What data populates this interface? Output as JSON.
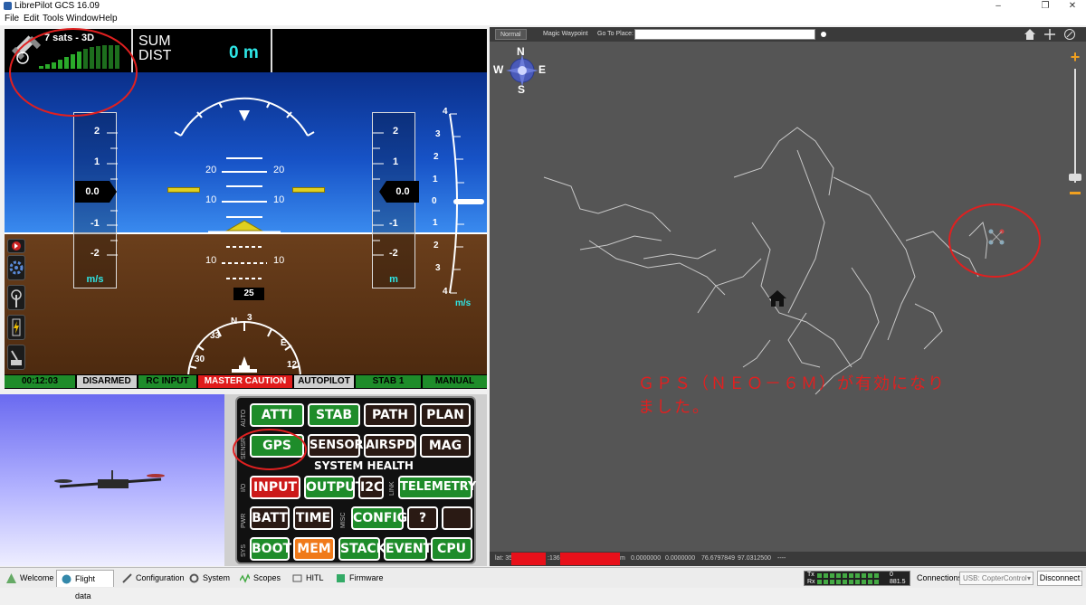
{
  "window": {
    "title": "LibrePilot GCS 16.09",
    "controls": {
      "minimize": "–",
      "maximize": "❐",
      "close": "✕"
    }
  },
  "menu": [
    "File",
    "Edit",
    "Tools",
    "Window",
    "Help"
  ],
  "pfd": {
    "gps_sats": "7 sats - 3D",
    "sum_label": "SUM",
    "dist_label": "DIST",
    "dist_value": "0 m",
    "speed_value": "0.0",
    "speed_unit": "m/s",
    "alt_value": "0.0",
    "alt_unit": "m",
    "vsi_unit": "m/s",
    "speed_ticks": [
      "2",
      "1",
      "-1",
      "-2"
    ],
    "alt_ticks": [
      "2",
      "1",
      "-1",
      "-2"
    ],
    "vsi_ticks": [
      "4",
      "3",
      "2",
      "1",
      "0",
      "1",
      "2",
      "3",
      "4"
    ],
    "pitch_up": [
      "20",
      "20",
      "10",
      "10"
    ],
    "pitch_down": [
      "10",
      "10"
    ],
    "heading_value": "25",
    "compass_labels": [
      "33",
      "N",
      "3",
      "E",
      "30",
      "12"
    ],
    "status": {
      "timer": "00:12:03",
      "armed": "DISARMED",
      "rc_input": "RC INPUT",
      "master_caution": "MASTER CAUTION",
      "autopilot": "AUTOPILOT",
      "stab": "STAB 1",
      "mode": "MANUAL"
    },
    "colors": {
      "sky": "#1753c7",
      "ground": "#5a3315",
      "accent": "#2ee6e6",
      "attitude": "#e0d020"
    }
  },
  "health": {
    "title": "SYSTEM HEALTH",
    "rows": {
      "auto": {
        "label": "AUTO",
        "items": [
          "ATTI",
          "STAB",
          "PATH",
          "PLAN"
        ]
      },
      "sensr": {
        "label": "SENSR",
        "items": [
          "GPS",
          "SENSOR",
          "AIRSPD",
          "MAG"
        ]
      },
      "io": {
        "label": "I/O",
        "items": [
          "INPUT",
          "OUTPUT",
          "I2C"
        ]
      },
      "link": {
        "label": "LINK",
        "items": [
          "TELEMETRY"
        ]
      },
      "pwr": {
        "label": "PWR",
        "items": [
          "BATT",
          "TIME"
        ]
      },
      "misc": {
        "label": "MISC",
        "items": [
          "CONFIG",
          "?",
          ""
        ]
      },
      "sys": {
        "label": "SYS",
        "items": [
          "BOOT",
          "MEM",
          "STACK",
          "EVENT",
          "CPU"
        ]
      }
    }
  },
  "map": {
    "toolbar": {
      "normal": "Normal",
      "magic": "Magic Waypoint",
      "goto_label": "Go To Place:",
      "goto_value": ""
    },
    "compass": [
      "N",
      "W",
      "E",
      "S"
    ],
    "annotation_line1": "ＧＰＳ（ＮＥＯ－６Ｍ）が有効になり",
    "annotation_line2": "ました。",
    "status": {
      "lat": "lat: 35",
      "lon": ":136",
      "unit": "m",
      "v1": "0.0000000",
      "v2": "0.0000000",
      "v3": "76.6797849",
      "v4": "97.0312500",
      "dash": "----"
    }
  },
  "tabs": [
    "Welcome",
    "Flight data",
    "Configuration",
    "System",
    "Scopes",
    "HITL",
    "Firmware"
  ],
  "footer": {
    "tx_label": "Tx",
    "rx_label": "Rx",
    "tx_value": "0",
    "rx_value": "881.5",
    "connections_label": "Connections:",
    "connection_value": "USB: CopterControl",
    "disconnect": "Disconnect"
  }
}
